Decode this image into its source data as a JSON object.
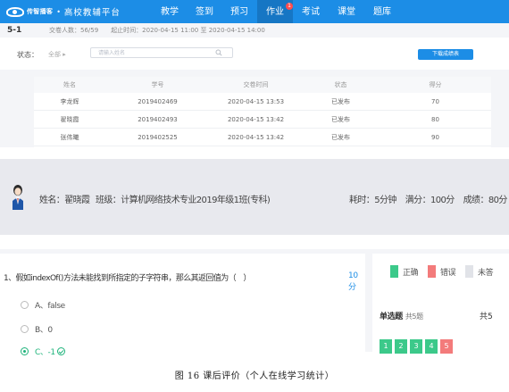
{
  "nav": {
    "brand": "传智播客",
    "separator": "•",
    "platform": "高校教辅平台",
    "items": [
      {
        "label": "教学",
        "active": false
      },
      {
        "label": "签到",
        "active": false
      },
      {
        "label": "预习",
        "active": false
      },
      {
        "label": "作业",
        "active": true,
        "badge": "1"
      },
      {
        "label": "考试",
        "active": false
      },
      {
        "label": "课堂",
        "active": false
      },
      {
        "label": "题库",
        "active": false
      }
    ]
  },
  "assignment": {
    "id": "5-1",
    "submit_count": "交卷人数：56/59",
    "time_range": "起止时间：2020-04-15 11:00  至  2020-04-15 14:00"
  },
  "filter": {
    "status_label": "状态：",
    "status_value": "全部",
    "search_placeholder": "请输入姓名",
    "download_label": "下载成绩表"
  },
  "table": {
    "headers": [
      "姓名",
      "学号",
      "交卷时间",
      "状态",
      "得分"
    ],
    "rows": [
      [
        "李龙辉",
        "2019402469",
        "2020-04-15 13:53",
        "已发布",
        "70"
      ],
      [
        "翟晓霞",
        "2019402493",
        "2020-04-15 13:42",
        "已发布",
        "80"
      ],
      [
        "张伟曦",
        "2019402525",
        "2020-04-15 13:42",
        "已发布",
        "90"
      ]
    ]
  },
  "student": {
    "name": "姓名：翟晓霞",
    "class": "班级：计算机网络技术专业2019年级1班(专科)",
    "time_used": "耗时：5分钟",
    "full_score": "满分：100分",
    "score": "成绩：80分"
  },
  "question": {
    "text": "1、假如indexOf()方法未能找到所指定的子字符串，那么其返回值为（　）",
    "points": "10分",
    "options": [
      {
        "label": "A、false",
        "selected": false
      },
      {
        "label": "B、0",
        "selected": false
      },
      {
        "label": "C、-1",
        "selected": true
      }
    ]
  },
  "answer_card": {
    "legend": [
      {
        "label": "正确",
        "color": "#3cc98a"
      },
      {
        "label": "错误",
        "color": "#f37b7b"
      },
      {
        "label": "未答",
        "color": "#e1e3e8"
      }
    ],
    "section_title": "单选题",
    "section_count": "共5题",
    "section_right": "共5",
    "numbers": [
      {
        "n": "1",
        "color": "#3cc98a"
      },
      {
        "n": "2",
        "color": "#3cc98a"
      },
      {
        "n": "3",
        "color": "#3cc98a"
      },
      {
        "n": "4",
        "color": "#3cc98a"
      },
      {
        "n": "5",
        "color": "#f37b7b"
      }
    ]
  },
  "caption": "图 16  课后评价（个人在线学习统计）"
}
